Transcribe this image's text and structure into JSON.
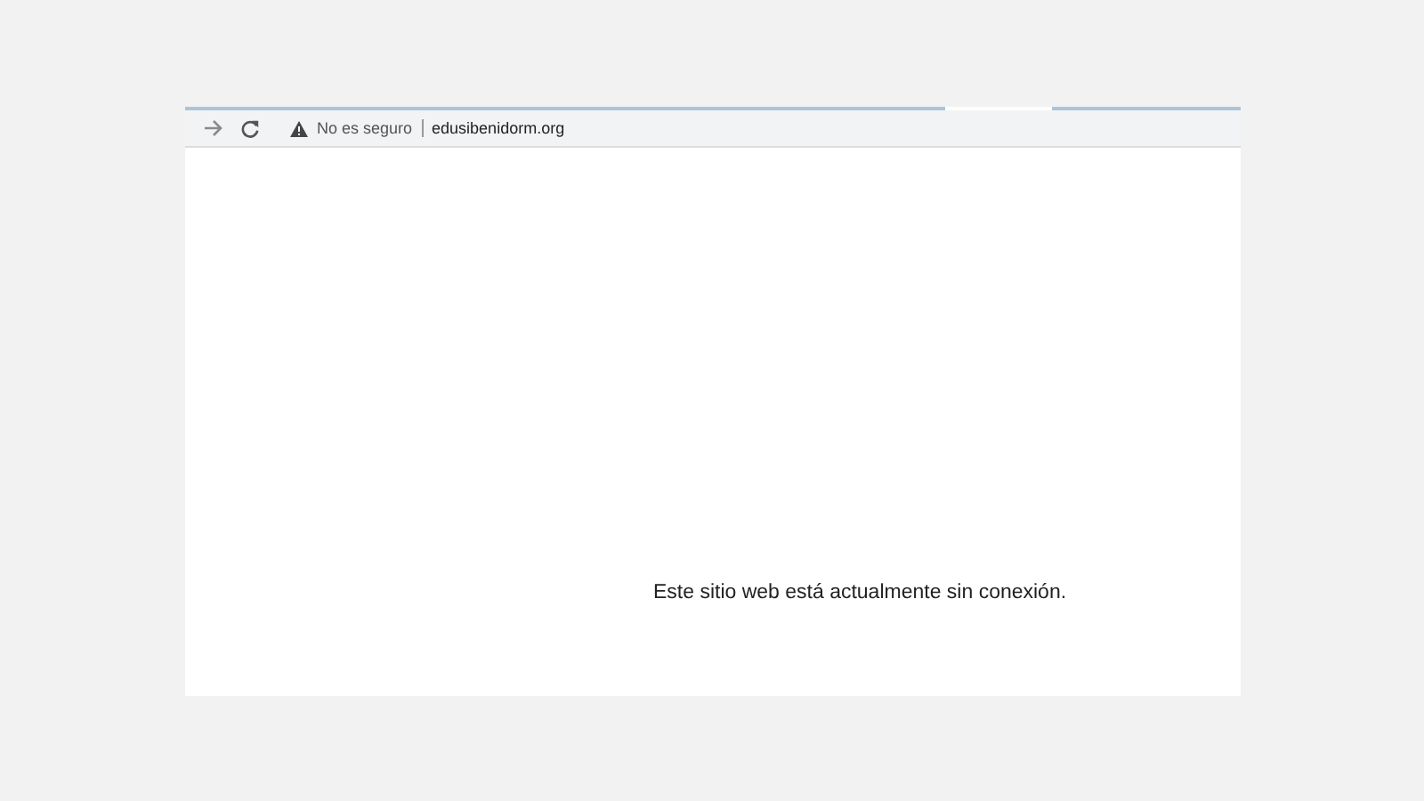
{
  "address_bar": {
    "security_label": "No es seguro",
    "url": "edusibenidorm.org"
  },
  "page": {
    "message": "Este sitio web está actualmente sin conexión."
  }
}
